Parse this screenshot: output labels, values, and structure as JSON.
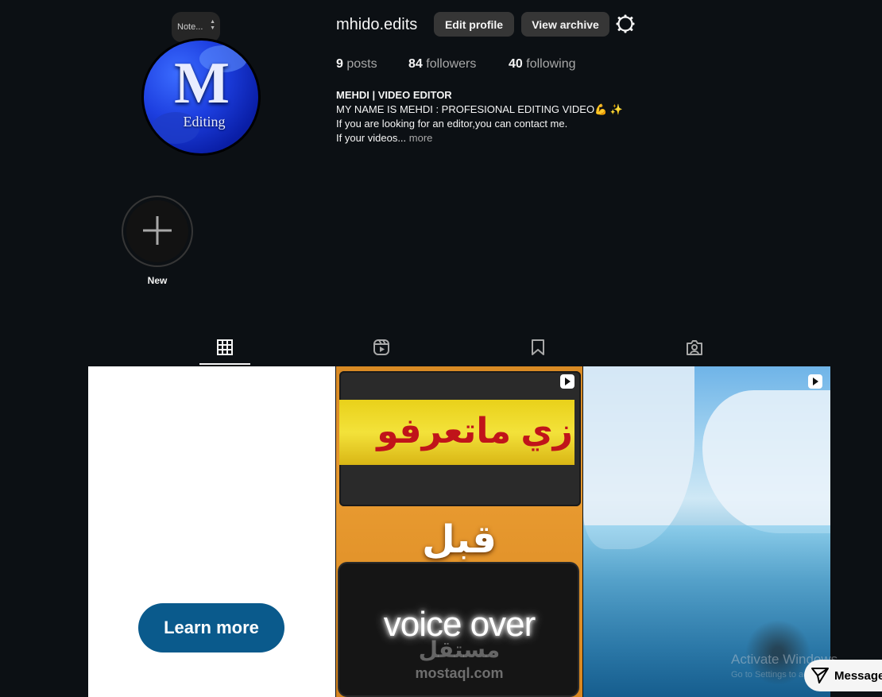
{
  "profile": {
    "note_placeholder": "Note...",
    "username": "mhido.edits",
    "avatar_monogram": "M",
    "avatar_word": "Editing",
    "edit_profile_label": "Edit profile",
    "view_archive_label": "View archive",
    "posts_count": "9",
    "posts_label": "posts",
    "followers_count": "84",
    "followers_label": "followers",
    "following_count": "40",
    "following_label": "following",
    "bio_name": "MEHDI | VIDEO EDITOR",
    "bio_line1": "MY NAME IS MEHDI : PROFESIONAL EDITING VIDEO💪 ✨",
    "bio_line2": "If you are looking for an editor,you can contact me.",
    "bio_line3": "If your videos...",
    "bio_more": "more"
  },
  "highlights": {
    "new_label": "New"
  },
  "tabs": [
    {
      "icon": "grid-icon",
      "active": true
    },
    {
      "icon": "reels-icon",
      "active": false
    },
    {
      "icon": "saved-icon",
      "active": false
    },
    {
      "icon": "tagged-icon",
      "active": false
    }
  ],
  "posts": {
    "tile1_button": "Learn more",
    "tile2_arabic_top": "زي ماتعرفو",
    "tile2_arabic_mid": "قبل",
    "tile2_voice_over": "voice over",
    "tile2_watermark_ar": "مستقل",
    "tile2_watermark": "mostaql.com"
  },
  "overlay": {
    "windows_line1": "Activate Windows",
    "windows_line2": "Go to Settings to activate Windows.",
    "message_label": "Messages"
  }
}
